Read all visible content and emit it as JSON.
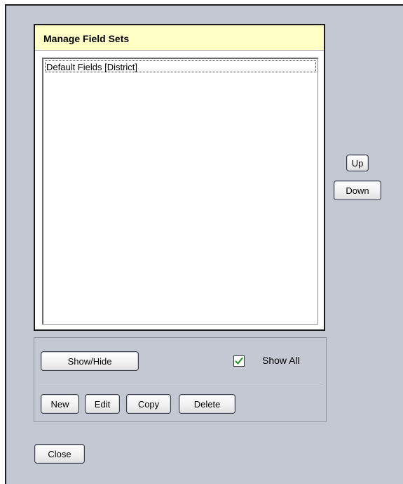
{
  "dialog": {
    "title": "Manage Field Sets",
    "list_items": [
      "Default Fields [District]"
    ],
    "buttons": {
      "up": "Up",
      "down": "Down",
      "show_hide": "Show/Hide",
      "new": "New",
      "edit": "Edit",
      "copy": "Copy",
      "delete": "Delete",
      "close": "Close"
    },
    "show_all": {
      "label": "Show All",
      "checked": true
    }
  },
  "colors": {
    "background": "#c3c8d2",
    "title_bar": "#ffffc6",
    "check_mark": "#2e9a2e"
  }
}
